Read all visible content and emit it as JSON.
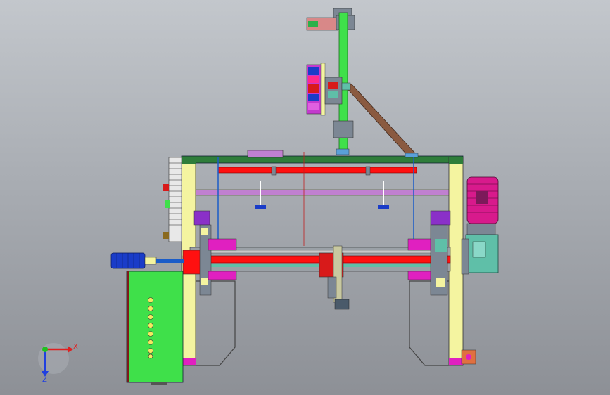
{
  "colors": {
    "frame_yellow": "#f4f4a0",
    "frame_green": "#2e7d3a",
    "shaft_red": "#ff1010",
    "panel_green": "#3fe04a",
    "magenta": "#e020c0",
    "motor_magenta": "#d81a8c",
    "gearbox_teal": "#5fbfa8",
    "blue_cylinder": "#1a3cc8",
    "brown_strut": "#8a5a40",
    "purple_beam": "#c080d0"
  },
  "triad": {
    "x_label": "X",
    "z_label": "Z",
    "x_color": "#e02020",
    "z_color": "#2040e0",
    "origin_color": "#20c020"
  },
  "indicator_lights": 8
}
